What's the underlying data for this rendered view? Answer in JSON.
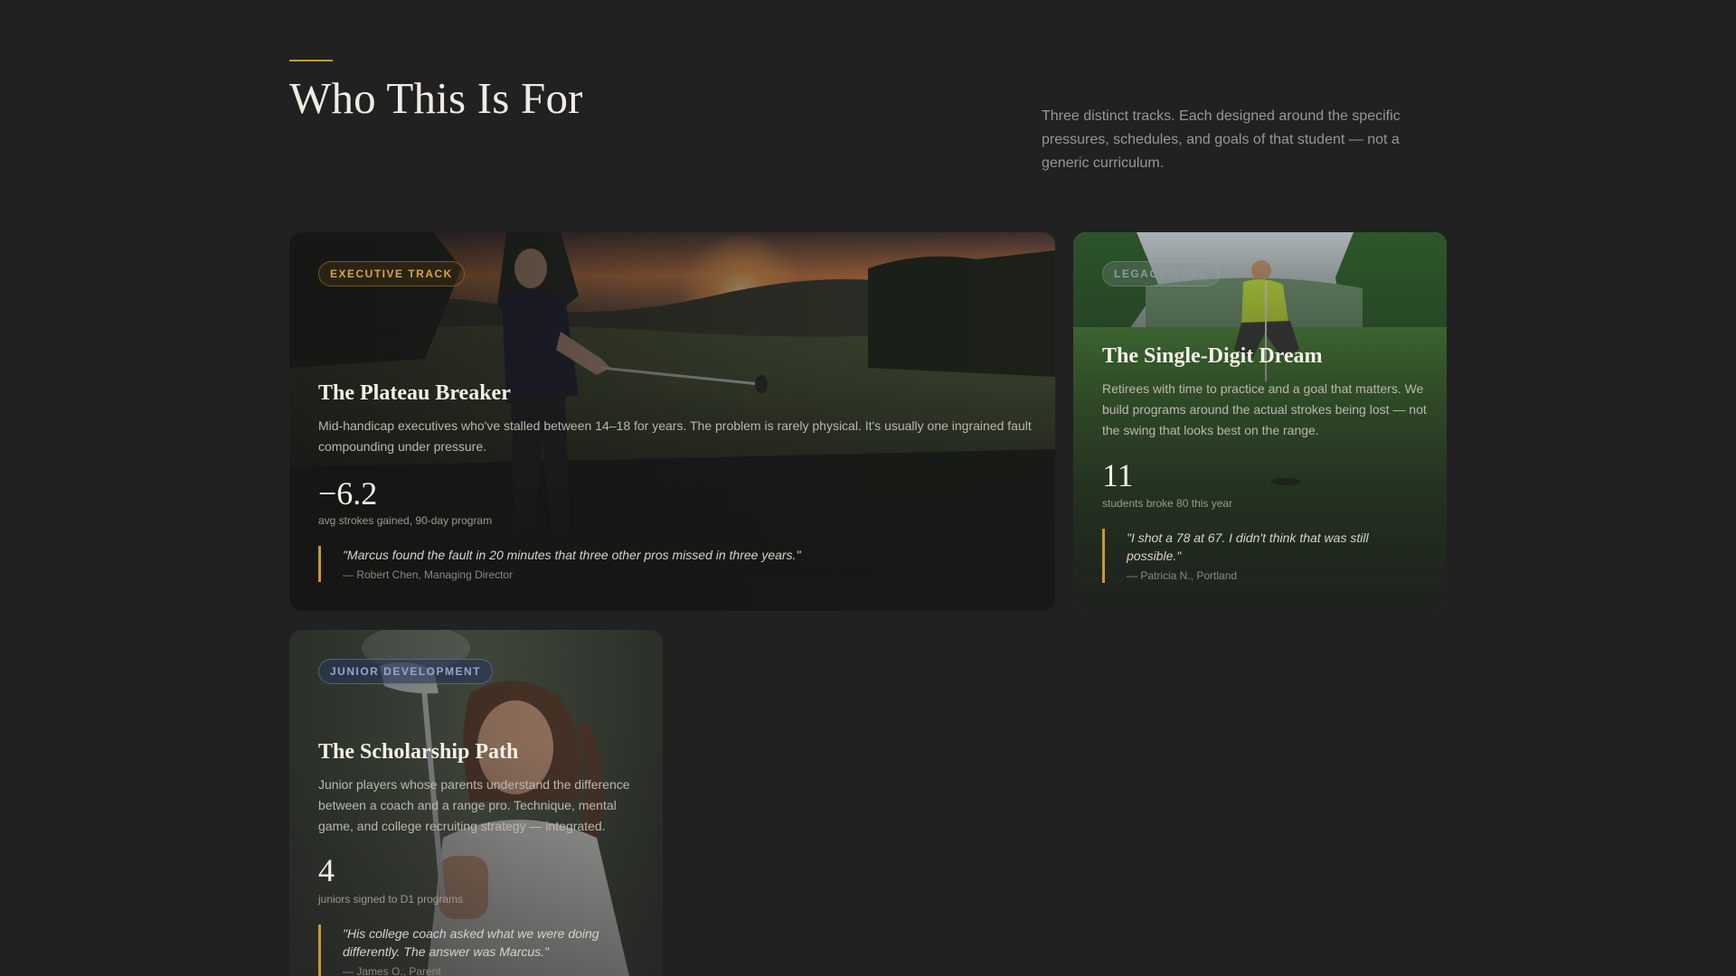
{
  "section": {
    "title": "Who This Is For",
    "intro": "Three distinct tracks. Each designed around the specific pressures, schedules, and goals of that student — not a generic curriculum."
  },
  "cards": [
    {
      "badge": "EXECUTIVE TRACK",
      "title": "The Plateau Breaker",
      "description": "Mid-handicap executives who've stalled between 14–18 for years. The problem is rarely physical. It's usually one ingrained fault compounding under pressure.",
      "stat_value": "−6.2",
      "stat_label": "avg strokes gained, 90-day program",
      "quote": "\"Marcus found the fault in 20 minutes that three other pros missed in three years.\"",
      "quote_author": "— Robert Chen, Managing Director",
      "image": "golfer-sunset-swing-photo"
    },
    {
      "badge": "LEGACY GOAL",
      "title": "The Single-Digit Dream",
      "description": "Retirees with time to practice and a goal that matters. We build programs around the actual strokes being lost — not the swing that looks best on the range.",
      "stat_value": "11",
      "stat_label": "students broke 80 this year",
      "quote": "\"I shot a 78 at 67. I didn't think that was still possible.\"",
      "quote_author": "— Patricia N., Portland",
      "image": "golfer-reading-green-photo"
    },
    {
      "badge": "JUNIOR DEVELOPMENT",
      "title": "The Scholarship Path",
      "description": "Junior players whose parents understand the difference between a coach and a range pro. Technique, mental game, and college recruiting strategy — integrated.",
      "stat_value": "4",
      "stat_label": "juniors signed to D1 programs",
      "quote": "\"His college coach asked what we were doing differently. The answer was Marcus.\"",
      "quote_author": "— James O., Parent",
      "image": "junior-golfer-wedge-photo"
    }
  ],
  "colors": {
    "background": "#212121",
    "accent": "#c9973a",
    "junior_badge": "#8ea7d2"
  }
}
